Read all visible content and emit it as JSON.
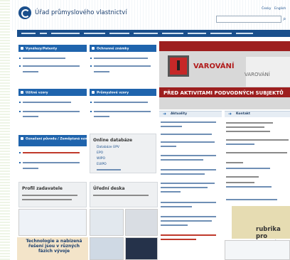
{
  "header": {
    "site_title": "Úřad průmyslového vlastnictví",
    "lang_cz": "Česky",
    "lang_en": "English"
  },
  "cards": {
    "patents": {
      "title": "Vynálezy/Patenty"
    },
    "utility": {
      "title": "Užitné vzory"
    },
    "trademarks": {
      "title": "Ochranné známky"
    },
    "designs": {
      "title": "Průmyslové vzory"
    },
    "appellations": {
      "title": "Označení původu / Zeměpisná označení"
    }
  },
  "databases": {
    "title": "Online databáze",
    "items": [
      "Databáze ÚPV",
      "EPO",
      "WIPO",
      "EUIPO"
    ]
  },
  "profile": {
    "title": "Profil zadavatele"
  },
  "board": {
    "title": "Úřední deska"
  },
  "banner": {
    "warning": "VAROVÁNÍ",
    "warning_sub": "VAROVÁNÍ",
    "caption": "PŘED AKTIVITAMI PODVODNÝCH SUBJEKTŮ"
  },
  "news": {
    "title": "Aktuality"
  },
  "contact": {
    "title": "Kontakt"
  },
  "promo": {
    "tile_text": "Technologie a nabízená řešení jsou v různých fázích vývoje",
    "rubrika": "rubrika pro mladé"
  },
  "colors": {
    "navbar": "#1a4f8c",
    "card_header": "#1f64ad",
    "warning_red": "#b11c1c"
  }
}
